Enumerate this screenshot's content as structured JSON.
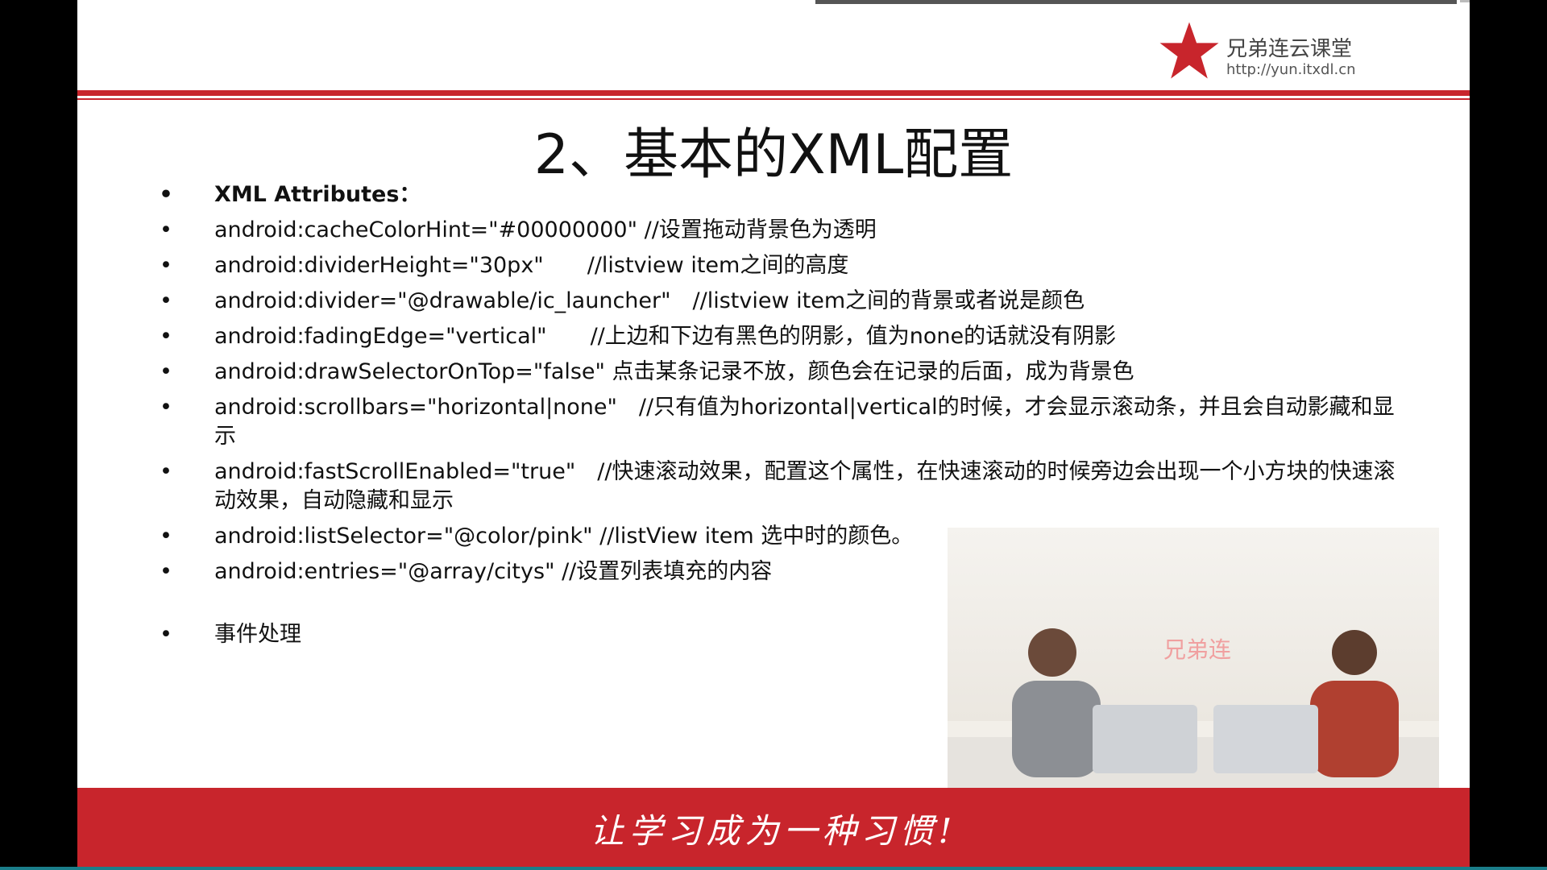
{
  "logo": {
    "name": "兄弟连云课堂",
    "url": "http://yun.itxdl.cn"
  },
  "slide": {
    "title": "2、基本的XML配置",
    "bullets": [
      {
        "text": "XML Attributes："
      },
      {
        "text": "android:cacheColorHint=\"#00000000\" //设置拖动背景色为透明"
      },
      {
        "text": "android:dividerHeight=\"30px\"　　//listview item之间的高度"
      },
      {
        "text": "android:divider=\"@drawable/ic_launcher\"　//listview item之间的背景或者说是颜色"
      },
      {
        "text": "android:fadingEdge=\"vertical\"　　//上边和下边有黑色的阴影，值为none的话就没有阴影"
      },
      {
        "text": "android:drawSelectorOnTop=\"false\" 点击某条记录不放，颜色会在记录的后面，成为背景色"
      },
      {
        "text": "android:scrollbars=\"horizontal|none\"　//只有值为horizontal|vertical的时候，才会显示滚动条，并且会自动影藏和显示"
      },
      {
        "text": "android:fastScrollEnabled=\"true\"　//快速滚动效果，配置这个属性，在快速滚动的时候旁边会出现一个小方块的快速滚动效果，自动隐藏和显示"
      },
      {
        "text": "android:listSelector=\"@color/pink\" //listView item 选中时的颜色。"
      },
      {
        "text": "android:entries=\"@array/citys\" //设置列表填充的内容"
      },
      {
        "text": "事件处理"
      }
    ],
    "bullet_symbol": "•",
    "slogan": "让学习成为一种习惯!"
  },
  "video": {
    "brand": "兄弟连"
  },
  "colors": {
    "brand_red": "#c8252c",
    "text": "#111111"
  }
}
